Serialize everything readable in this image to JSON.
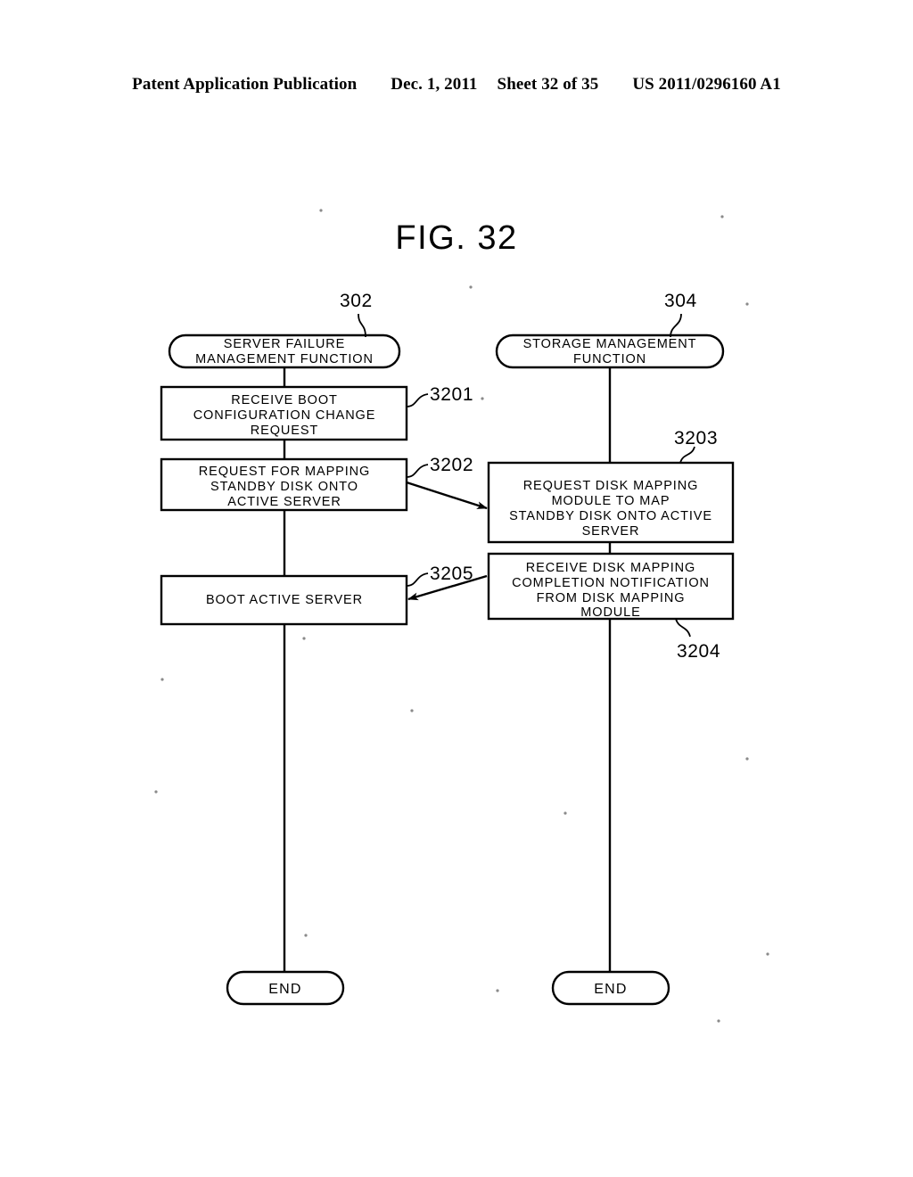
{
  "header": {
    "publication": "Patent Application Publication",
    "date": "Dec. 1, 2011",
    "sheet": "Sheet 32 of 35",
    "patent_number": "US 2011/0296160 A1"
  },
  "figure": {
    "title": "FIG. 32"
  },
  "diagram": {
    "type": "flowchart",
    "lanes": [
      {
        "id": "left",
        "start_label": "302",
        "start_text_lines": [
          "SERVER  FAILURE",
          "MANAGEMENT  FUNCTION"
        ],
        "end_text": "END"
      },
      {
        "id": "right",
        "start_label": "304",
        "start_text_lines": [
          "STORAGE  MANAGEMENT",
          "FUNCTION"
        ],
        "end_text": "END"
      }
    ],
    "steps": [
      {
        "ref": "3201",
        "lane": "left",
        "lines": [
          "RECEIVE  BOOT",
          "CONFIGURATION  CHANGE",
          "REQUEST"
        ]
      },
      {
        "ref": "3202",
        "lane": "left",
        "lines": [
          "REQUEST  FOR  MAPPING",
          "STANDBY  DISK  ONTO",
          "ACTIVE  SERVER"
        ]
      },
      {
        "ref": "3203",
        "lane": "right",
        "lines": [
          "REQUEST  DISK  MAPPING",
          "MODULE  TO  MAP",
          "STANDBY  DISK  ONTO  ACTIVE",
          "SERVER"
        ]
      },
      {
        "ref": "3204",
        "lane": "right",
        "lines": [
          "RECEIVE  DISK  MAPPING",
          "COMPLETION  NOTIFICATION",
          "FROM  DISK  MAPPING",
          "MODULE"
        ]
      },
      {
        "ref": "3205",
        "lane": "left",
        "lines": [
          "BOOT  ACTIVE  SERVER"
        ]
      }
    ],
    "cross_arrows": [
      {
        "from": "3202",
        "to": "3203",
        "direction": "right"
      },
      {
        "from": "3204",
        "to": "3205",
        "direction": "left"
      }
    ],
    "colors": {
      "ink": "#000000",
      "paper": "#ffffff"
    }
  }
}
